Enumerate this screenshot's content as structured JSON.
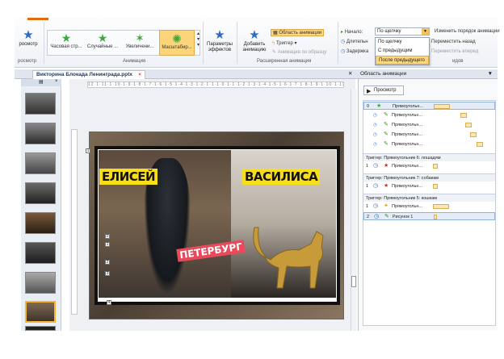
{
  "ribbon": {
    "preview_label": "росмотр",
    "preview_group": "росмотр",
    "effects": [
      "Часовая стр...",
      "Случайные ...",
      "Увеличени...",
      "Масштабир..."
    ],
    "animation_group": "Анимация",
    "effect_params_label": "Параметры эффектов",
    "add_anim_label": "Добавить анимацию",
    "anim_pane_label": "Область анимации",
    "trigger_label": "Триггер",
    "anim_painter_label": "Анимация по образцу",
    "ext_anim_group": "Расширенная анимация",
    "start_label": "Начало:",
    "start_value": "По щелчку",
    "duration_label": "Длительн",
    "delay_label": "Задержка",
    "timing_group_suffix": "идов",
    "reorder_label": "Изменить порядок анимации",
    "move_back_label": "Переместить назад",
    "move_forward_label": "Переместить вперед",
    "start_options": [
      "По щелчку",
      "С предыдущим",
      "После предыдущего"
    ]
  },
  "file_tab": {
    "title": "Викторина Блокада Ленинграда.pptx"
  },
  "slide": {
    "label_left": "ЕЛИСЕЙ",
    "label_right": "ВАСИЛИСА",
    "label_city": "ПЕТЕРБУРГ"
  },
  "ruler_text": "12·1·11·1·10·1·9·1·8·1·7·1·6·1·5·1·4·1·3·1·2·1·1·1·0·1·1·1·2·1·3·1·4·1·5·1·6·1·7·1·8·1·9·1·10·1·11·1·12",
  "pane": {
    "title": "Область анимации",
    "play_label": "Просмотр",
    "rows": [
      {
        "num": "0",
        "icon": "★",
        "text": "Прямоугольн..."
      },
      {
        "num": "",
        "icon": "✎",
        "text": "Прямоугольн..."
      },
      {
        "num": "",
        "icon": "✎",
        "text": "Прямоугольн..."
      },
      {
        "num": "",
        "icon": "✎",
        "text": "Прямоугольн..."
      },
      {
        "num": "",
        "icon": "✎",
        "text": "Прямоугольн..."
      }
    ],
    "trigger1": "Триггер: Прямоугольник 6: лошадям",
    "trigger1_row": {
      "num": "1",
      "icon": "★",
      "text": "Прямоугольн..."
    },
    "trigger2": "Триггер: Прямоугольник 7: собакам",
    "trigger2_row": {
      "num": "1",
      "icon": "★",
      "text": "Прямоугольн..."
    },
    "trigger3": "Триггер: Прямоугольник 5: кошкам",
    "trigger3_rows": [
      {
        "num": "1",
        "icon": "✦",
        "text": "Прямоугольн..."
      },
      {
        "num": "2",
        "icon": "✎",
        "text": "Рисунок 1"
      }
    ]
  },
  "colors": {
    "accent_orange": "#e36c0a",
    "label_yellow": "#f7de1d",
    "label_red": "#e8495b",
    "selection": "#fcd77d"
  }
}
